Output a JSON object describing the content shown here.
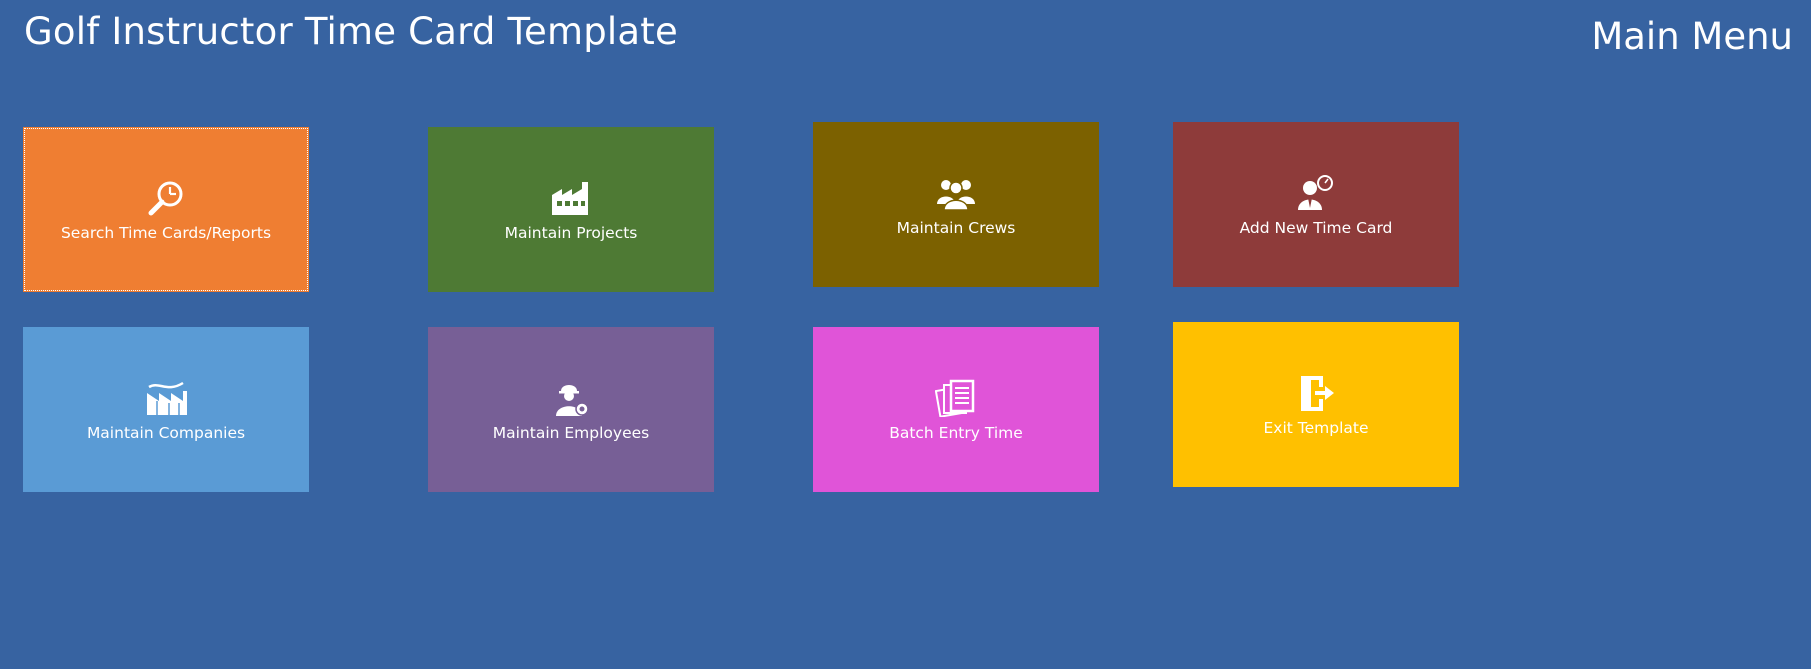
{
  "header": {
    "app_title": "Golf Instructor Time Card Template",
    "menu_title": "Main Menu"
  },
  "colors": {
    "background": "#3763A1",
    "search": "#EF7E32",
    "projects": "#4E7A34",
    "crews": "#7C6100",
    "add_time_card": "#8E3B3A",
    "companies": "#5A9BD5",
    "employees": "#775F96",
    "batch_entry": "#E054D8",
    "exit": "#FFC000"
  },
  "tiles": [
    {
      "id": "search",
      "label": "Search Time Cards/Reports",
      "icon": "magnifier-clock-icon",
      "focused": true
    },
    {
      "id": "projects",
      "label": "Maintain Projects",
      "icon": "factory-icon"
    },
    {
      "id": "crews",
      "label": "Maintain Crews",
      "icon": "group-icon"
    },
    {
      "id": "add_time_card",
      "label": "Add New Time Card",
      "icon": "person-clock-icon"
    },
    {
      "id": "companies",
      "label": "Maintain Companies",
      "icon": "industry-icon"
    },
    {
      "id": "employees",
      "label": "Maintain Employees",
      "icon": "worker-gear-icon"
    },
    {
      "id": "batch_entry",
      "label": "Batch Entry Time",
      "icon": "documents-icon"
    },
    {
      "id": "exit",
      "label": "Exit Template",
      "icon": "exit-door-icon"
    }
  ]
}
